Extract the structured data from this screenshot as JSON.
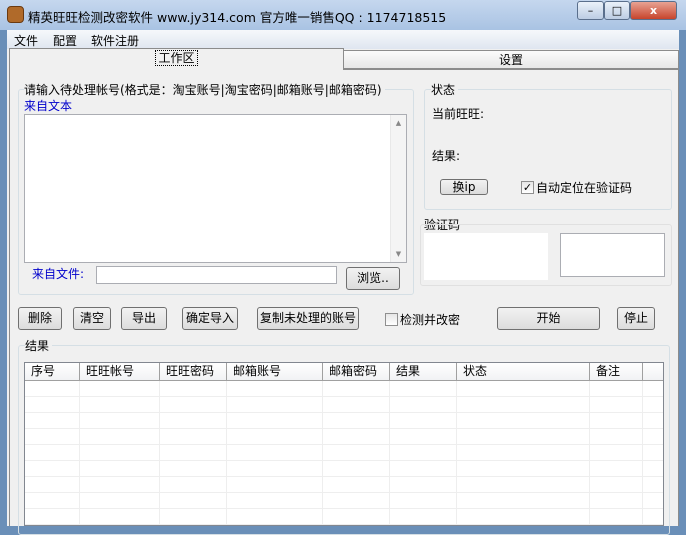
{
  "window": {
    "title": "精英旺旺检测改密软件  www.jy314.com 官方唯一销售QQ : 1174718515",
    "minimize": "–",
    "maximize": "□",
    "close": "x"
  },
  "menu": [
    "文件",
    "配置",
    "软件注册"
  ],
  "tabs": [
    "工作区",
    "设置"
  ],
  "input_group": {
    "label": "请输入待处理帐号(格式是：淘宝账号|淘宝密码|邮箱账号|邮箱密码)",
    "from_text": "来自文本",
    "textarea_value": "",
    "from_file": "来自文件:",
    "file_value": "",
    "browse": "浏览.."
  },
  "status": {
    "title": "状态",
    "current": "当前旺旺:",
    "result": "结果:",
    "change_ip": "换ip",
    "auto_locate": "自动定位在验证码",
    "auto_locate_checked": true
  },
  "captcha": {
    "title": "验证码"
  },
  "actions": {
    "delete": "删除",
    "clear": "清空",
    "export": "导出",
    "import": "确定导入",
    "copy_unprocessed": "复制未处理的账号",
    "check_change": "检测并改密",
    "check_change_checked": false,
    "start": "开始",
    "stop": "停止"
  },
  "results": {
    "title": "结果",
    "columns": [
      "序号",
      "旺旺帐号",
      "旺旺密码",
      "邮箱账号",
      "邮箱密码",
      "结果",
      "状态",
      "备注"
    ]
  }
}
